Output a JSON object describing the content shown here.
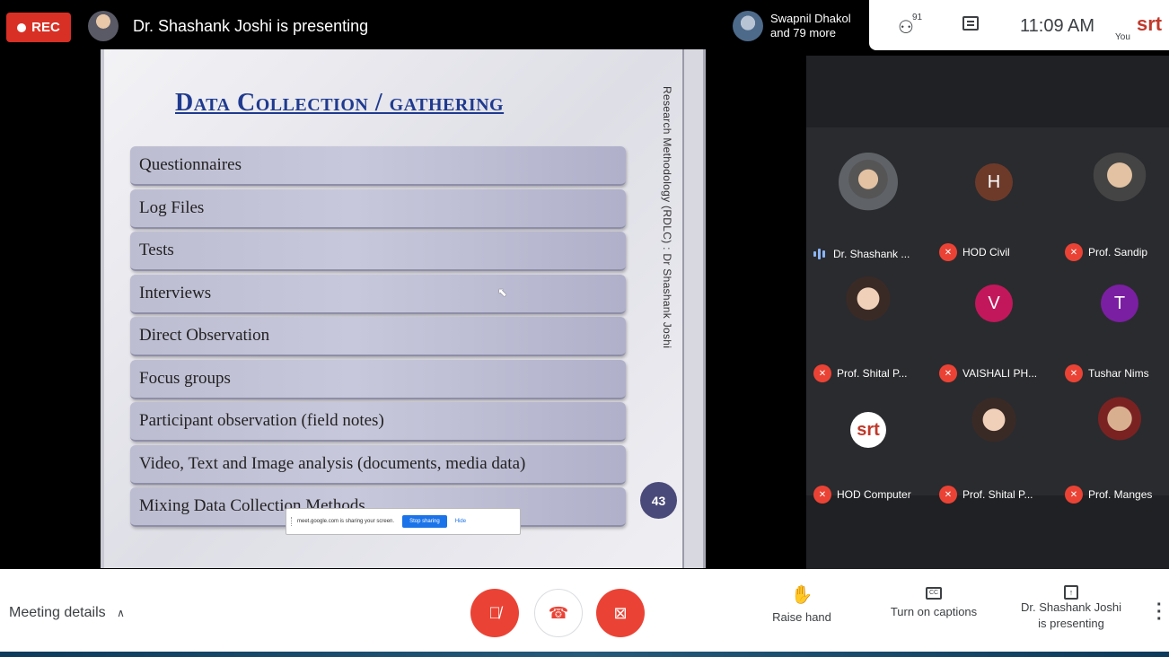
{
  "topbar": {
    "rec_label": "REC",
    "presenting_text": "Dr. Shashank Joshi is presenting",
    "viewer_line1": "Swapnil Dhakol",
    "viewer_line2": "and 79 more",
    "people_count": "91",
    "clock": "11:09 AM",
    "you_label": "You",
    "you_logo": "srt"
  },
  "slide": {
    "title": "Data Collection / gathering",
    "vertical_text": "Research Methodology (RDLC) : Dr Shashank Joshi",
    "items": [
      "Questionnaires",
      "Log Files",
      "Tests",
      "Interviews",
      "Direct Observation",
      "Focus groups",
      "Participant observation (field notes)",
      "Video, Text and Image analysis (documents, media data)",
      "Mixing Data Collection Methods"
    ],
    "page_number": "43"
  },
  "share_banner": {
    "text": "meet.google.com is sharing your screen.",
    "stop_label": "Stop sharing",
    "hide_label": "Hide"
  },
  "participants": [
    {
      "name": "Dr. Shashank ...",
      "initial": "",
      "muted": false
    },
    {
      "name": "HOD Civil",
      "initial": "H",
      "muted": true
    },
    {
      "name": "Prof. Sandip",
      "initial": "",
      "muted": true
    },
    {
      "name": "Prof. Shital P...",
      "initial": "",
      "muted": true
    },
    {
      "name": "VAISHALI PH...",
      "initial": "V",
      "muted": true
    },
    {
      "name": "Tushar Nims",
      "initial": "T",
      "muted": true
    },
    {
      "name": "HOD Computer",
      "initial": "srt",
      "muted": true
    },
    {
      "name": "Prof. Shital P...",
      "initial": "",
      "muted": true
    },
    {
      "name": "Prof. Manges",
      "initial": "",
      "muted": true
    }
  ],
  "bottombar": {
    "meeting_details": "Meeting details",
    "raise_hand": "Raise hand",
    "captions": "Turn on captions",
    "captions_icon": "CC",
    "presenting_line1": "Dr. Shashank Joshi",
    "presenting_line2": "is presenting"
  },
  "colors": {
    "rec_red": "#d93025",
    "mute_red": "#ea4335",
    "initial_h": "#6d3a2a",
    "initial_v": "#c2185b",
    "initial_t": "#7b1fa2"
  }
}
